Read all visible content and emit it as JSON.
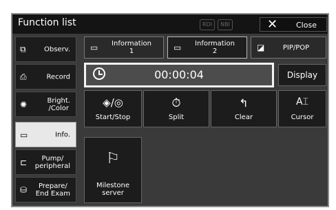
{
  "window": {
    "title": "Function list",
    "rdi": "RDI",
    "nbi": "NBI",
    "close_label": "Close"
  },
  "sidebar": {
    "items": [
      {
        "label": "Observ.",
        "icon": "observe-icon",
        "glyph": "⧉"
      },
      {
        "label": "Record",
        "icon": "record-icon",
        "glyph": "⎙"
      },
      {
        "label": "Bright.\n/Color",
        "icon": "brightness-icon",
        "glyph": "✺"
      },
      {
        "label": "Info.",
        "icon": "info-icon",
        "glyph": "▭",
        "active": true
      },
      {
        "label": "Pump/\nperipheral",
        "icon": "pump-icon",
        "glyph": "⊏"
      },
      {
        "label": "Prepare/\nEnd Exam",
        "icon": "prepare-icon",
        "glyph": "⛁"
      }
    ]
  },
  "tabs": [
    {
      "label": "Information",
      "sub": "1",
      "icon": "info-icon",
      "glyph": "▭"
    },
    {
      "label": "Information",
      "sub": "2",
      "icon": "info-icon",
      "glyph": "▭",
      "selected": true
    },
    {
      "label": "PIP/POP",
      "icon": "pip-icon",
      "glyph": "◪"
    }
  ],
  "timer": {
    "value": "00:00:04"
  },
  "display_button": {
    "label": "Display"
  },
  "buttons": [
    {
      "label": "Start/Stop",
      "icon": "start-stop-icon",
      "glyph": "◈/◎"
    },
    {
      "label": "Split",
      "icon": "split-icon",
      "glyph": "⏱"
    },
    {
      "label": "Clear",
      "icon": "clear-icon",
      "glyph": "↰"
    },
    {
      "label": "Cursor",
      "icon": "cursor-icon",
      "glyph": "A⌶"
    },
    {
      "label": "Milestone\nserver",
      "icon": "flag-icon",
      "glyph": "⚐"
    }
  ]
}
